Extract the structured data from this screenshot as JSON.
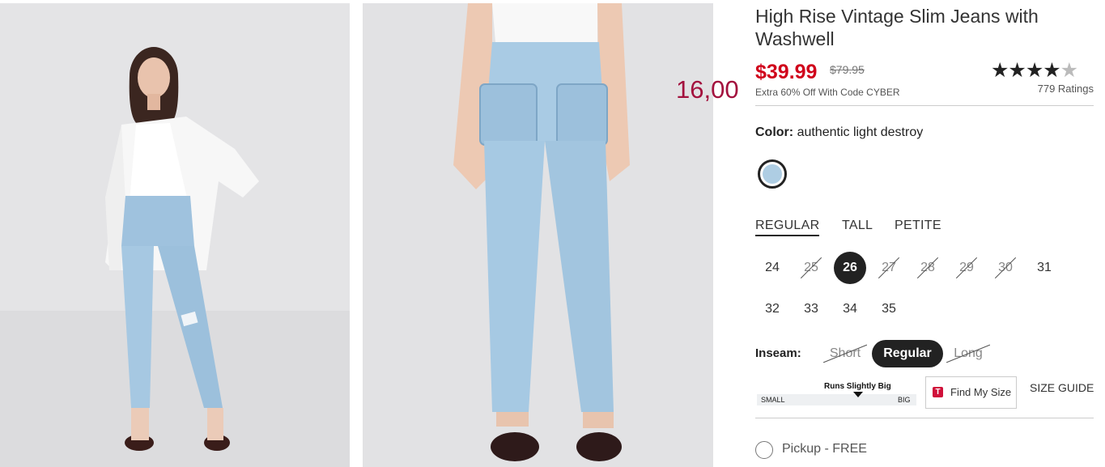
{
  "product": {
    "title": "High Rise Vintage Slim Jeans with Washwell",
    "sale_price": "$39.99",
    "original_price": "$79.95",
    "promo": "Extra 60% Off With Code CYBER",
    "rating_value": 4.5,
    "rating_stars": "★★★★",
    "rating_half": "★",
    "ratings_count": "779 Ratings"
  },
  "overlay_price": "16,00",
  "color": {
    "label": "Color:",
    "value": "authentic light destroy",
    "swatch_hex": "#aecde3"
  },
  "fit_tabs": [
    {
      "label": "REGULAR",
      "active": true
    },
    {
      "label": "TALL",
      "active": false
    },
    {
      "label": "PETITE",
      "active": false
    }
  ],
  "sizes": [
    {
      "label": "24",
      "state": "available"
    },
    {
      "label": "25",
      "state": "unavailable"
    },
    {
      "label": "26",
      "state": "selected"
    },
    {
      "label": "27",
      "state": "unavailable"
    },
    {
      "label": "28",
      "state": "unavailable"
    },
    {
      "label": "29",
      "state": "unavailable"
    },
    {
      "label": "30",
      "state": "unavailable"
    },
    {
      "label": "31",
      "state": "available"
    },
    {
      "label": "32",
      "state": "available"
    },
    {
      "label": "33",
      "state": "available"
    },
    {
      "label": "34",
      "state": "available"
    },
    {
      "label": "35",
      "state": "available"
    }
  ],
  "inseam": {
    "label": "Inseam:",
    "options": [
      {
        "label": "Short",
        "state": "unavailable"
      },
      {
        "label": "Regular",
        "state": "selected"
      },
      {
        "label": "Long",
        "state": "unavailable"
      }
    ]
  },
  "fit_scale": {
    "title": "Runs Slightly Big",
    "small_label": "SMALL",
    "big_label": "BIG"
  },
  "find_my_size": {
    "icon_letter": "T",
    "label": "Find My Size"
  },
  "size_guide": "SIZE GUIDE",
  "pickup": "Pickup - FREE",
  "colors": {
    "sale": "#d0021b",
    "overlay": "#a3123e",
    "selected_bg": "#222222"
  }
}
